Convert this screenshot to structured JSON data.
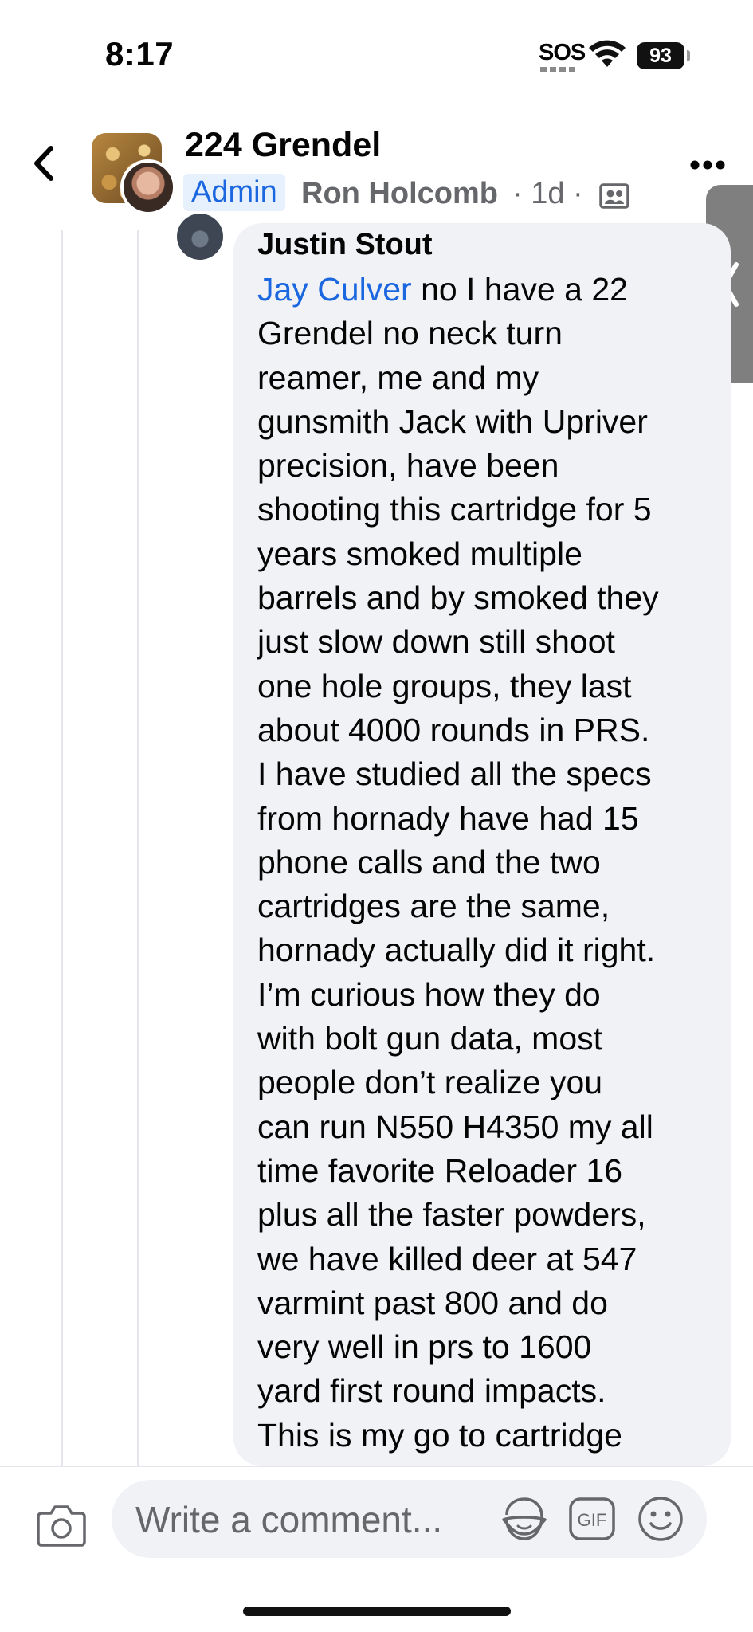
{
  "status_bar": {
    "time": "8:17",
    "sos": "SOS",
    "battery": "93"
  },
  "header": {
    "group_name": "224 Grendel",
    "role_badge": "Admin",
    "poster_name": "Ron Holcomb",
    "post_meta": "· 1d ·"
  },
  "comment": {
    "author": "Justin Stout",
    "mention": "Jay Culver",
    "text": " no I have a 22\nGrendel no neck turn\nreamer, me and my\ngunsmith Jack with  Upriver\nprecision, have been\nshooting this cartridge for 5\nyears smoked multiple\nbarrels and by smoked they\njust slow down still shoot\none hole groups, they last\nabout 4000 rounds in PRS.\nI have studied all the specs\nfrom hornady have had 15\nphone calls and the two\ncartridges are the same,\nhornady actually did it right.\nI’m curious how they do\nwith bolt gun data, most\npeople don’t realize you\ncan run N550 H4350 my all\ntime favorite Reloader 16\nplus all the faster powders,\nwe have killed deer at 547\nvarmint past 800 and do\nvery well in prs to 1600\nyard first round impacts.\nThis is my go to cartridge"
  },
  "composer": {
    "placeholder": "Write a comment...",
    "gif_label": "GIF"
  },
  "icons": {
    "back": "chevron-left-icon",
    "more": "more-horizontal-icon",
    "privacy": "group-members-icon",
    "drawer": "chevron-left-icon",
    "camera": "camera-icon",
    "sticker": "avatar-sticker-icon",
    "gif": "gif-icon",
    "emoji": "emoji-icon"
  },
  "colors": {
    "link_blue": "#1b67e0",
    "bubble_bg": "#f0f2f5",
    "meta_gray": "#65676b"
  }
}
